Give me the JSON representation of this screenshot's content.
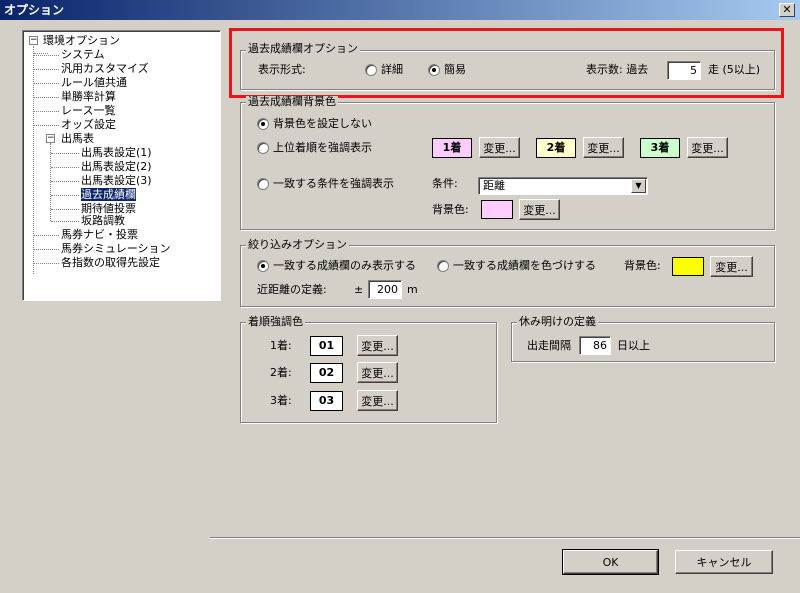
{
  "window": {
    "title": "オプション",
    "close_glyph": "✕"
  },
  "tree": {
    "root": "環境オプション",
    "items": [
      "システム",
      "汎用カスタマイズ",
      "ルール値共通",
      "単勝率計算",
      "レース一覧",
      "オッズ設定",
      "出馬表"
    ],
    "children": [
      "出馬表設定(1)",
      "出馬表設定(2)",
      "出馬表設定(3)",
      "過去成績欄",
      "期待値投票",
      "坂路調教"
    ],
    "items_after": [
      "馬券ナビ・投票",
      "馬券シミュレーション",
      "各指数の取得先設定"
    ],
    "toggle_minus": "−",
    "selected": "過去成績欄"
  },
  "past_results": {
    "group_label": "過去成績欄オプション",
    "format_label": "表示形式:",
    "detail_label": "詳細",
    "simple_label": "簡易",
    "selected_format": "簡易",
    "count_label": "表示数: 過去",
    "count_value": "5",
    "count_suffix": "走 (5以上)"
  },
  "bg_color": {
    "group_label": "過去成績欄背景色",
    "no_bg_label": "背景色を設定しない",
    "highlight_rank_label": "上位着順を強調表示",
    "rank1": "1着",
    "rank2": "2着",
    "rank3": "3着",
    "rank1_color": "#ffccff",
    "rank2_color": "#ffffcc",
    "rank3_color": "#ccffcc",
    "change": "変更...",
    "match_label": "一致する条件を強調表示",
    "condition_label": "条件:",
    "condition_value": "距離",
    "bg_label": "背景色:",
    "match_color": "#ffccff",
    "dropdown_arrow": "▼"
  },
  "filter": {
    "group_label": "絞り込みオプション",
    "only_matching_label": "一致する成績欄のみ表示する",
    "color_matching_label": "一致する成績欄を色づけする",
    "bg_label": "背景色:",
    "bg_color": "#ffff00",
    "change": "変更...",
    "distance_label": "近距離の定義:",
    "plus_minus": "±",
    "distance_value": "200",
    "distance_unit": "m"
  },
  "rank_color": {
    "group_label": "着順強調色",
    "rows": [
      {
        "label": "1着:",
        "value": "01"
      },
      {
        "label": "2着:",
        "value": "02"
      },
      {
        "label": "3着:",
        "value": "03"
      }
    ],
    "change": "変更..."
  },
  "rest": {
    "group_label": "休み明けの定義",
    "interval_label": "出走間隔",
    "interval_value": "86",
    "interval_suffix": "日以上"
  },
  "footer": {
    "ok": "OK",
    "cancel": "キャンセル"
  },
  "colors": {
    "highlight_box": "#e8151b",
    "titlebar": "#0a246a",
    "selection": "#0a246a"
  }
}
